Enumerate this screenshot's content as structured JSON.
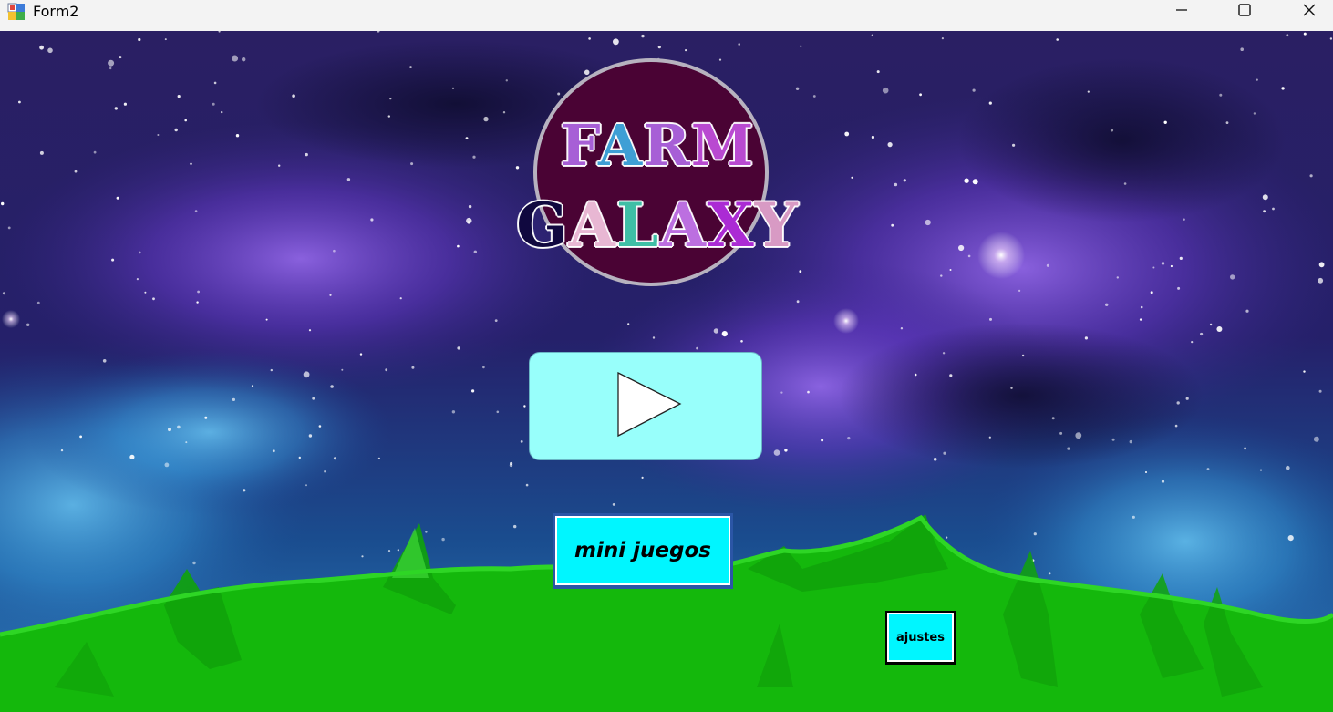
{
  "window": {
    "title": "Form2",
    "app_icon": "winforms-app-icon",
    "controls": [
      "minimize-icon",
      "maximize-icon",
      "close-icon"
    ]
  },
  "logo": {
    "line1": [
      "F",
      "A",
      "R",
      "M"
    ],
    "line2": [
      "G",
      "A",
      "L",
      "A",
      "X",
      "Y"
    ],
    "line1_colors": [
      "#a75fd6",
      "#3e9fd5",
      "#a75fd6",
      "#b94ad1"
    ],
    "line2_colors": [
      "#10083f",
      "#e8b7d3",
      "#3fbfa6",
      "#bc6fe0",
      "#ab2bd4",
      "#d89ac4"
    ],
    "circle_color": "#4a0334"
  },
  "buttons": {
    "play": {
      "icon": "play-icon",
      "color": "#98fffb"
    },
    "mini_juegos": {
      "label": "mini juegos",
      "color": "#00f6ff"
    },
    "ajustes": {
      "label": "ajustes",
      "color": "#00f6ff"
    }
  },
  "colors": {
    "space": "#241a5e",
    "nebula": "#6a3ccf",
    "grass": "#14b80c"
  }
}
